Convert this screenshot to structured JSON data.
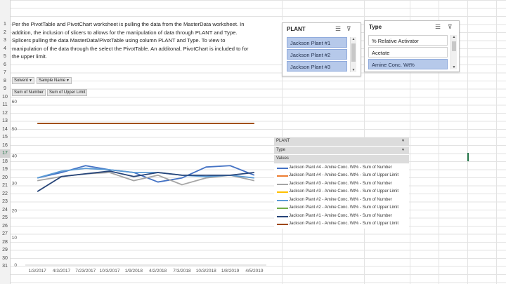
{
  "rows": [
    "1",
    "2",
    "3",
    "4",
    "5",
    "6",
    "7",
    "8",
    "9",
    "10",
    "11",
    "12",
    "13",
    "14",
    "15",
    "16",
    "17",
    "18",
    "19",
    "20",
    "21",
    "22",
    "23",
    "24",
    "25",
    "26",
    "27",
    "28",
    "29",
    "30",
    "31"
  ],
  "active_row": 17,
  "description": {
    "lines": [
      "Per the PivotTable and PivotChart worksheet is pulling the data from the MasterData worksheet. In",
      "addition, the inclusion of slicers to allows for the manipulation of data through PLANT and Type.",
      "Splicers pulling the data MasterData/PivotTable using column PLANT and Type. To view to",
      "manipulation of the data through the select the PivotTable. An additonal, PivotChart is included to for",
      "the upper limit."
    ]
  },
  "pivot_filters": [
    {
      "label": "Solvent",
      "icon": "dropdown-icon"
    },
    {
      "label": "Sample Name",
      "icon": "dropdown-icon"
    }
  ],
  "pivot_values": [
    "Sum of Number",
    "Sum of Upper Limit"
  ],
  "plant_slicer": {
    "title": "PLANT",
    "items": [
      {
        "label": "Jackson Plant #1",
        "selected": true
      },
      {
        "label": "Jackson Plant #2",
        "selected": true
      },
      {
        "label": "Jackson Plant #3",
        "selected": true
      }
    ]
  },
  "type_slicer": {
    "title": "Type",
    "items": [
      {
        "label": "% Relative Activator",
        "selected": false
      },
      {
        "label": "Acetate",
        "selected": false
      },
      {
        "label": "Amine Conc. Wt%",
        "selected": true
      }
    ]
  },
  "legend": {
    "headers": [
      "PLANT",
      "Type",
      "Values"
    ],
    "entries": [
      {
        "label": "Jackson Plant #4 - Amine Conc. Wt% - Sum of Number",
        "color": "#4472c4"
      },
      {
        "label": "Jackson Plant #4 - Amine Conc. Wt% - Sum of Upper Limit",
        "color": "#ed7d31"
      },
      {
        "label": "Jackson Plant #3 - Amine Conc. Wt% - Sum of Number",
        "color": "#a5a5a5"
      },
      {
        "label": "Jackson Plant #3 - Amine Conc. Wt% - Sum of Upper Limit",
        "color": "#ffc000"
      },
      {
        "label": "Jackson Plant #2 - Amine Conc. Wt% - Sum of Number",
        "color": "#5b9bd5"
      },
      {
        "label": "Jackson Plant #2 - Amine Conc. Wt% - Sum of Upper Limit",
        "color": "#70ad47"
      },
      {
        "label": "Jackson Plant #1 - Amine Conc. Wt% - Sum of Number",
        "color": "#264478"
      },
      {
        "label": "Jackson Plant #1 - Amine Conc. Wt% - Sum of Upper Limit",
        "color": "#9e480e"
      }
    ]
  },
  "chart_data": {
    "type": "line",
    "title": "",
    "xlabel": "",
    "ylabel": "",
    "ylim": [
      0,
      60
    ],
    "yticks": [
      0,
      10,
      20,
      30,
      40,
      50,
      60
    ],
    "grid": false,
    "legend_position": "right",
    "categories": [
      "1/3/2017",
      "4/3/2017",
      "7/23/2017",
      "10/3/2017",
      "1/9/2018",
      "4/2/2018",
      "7/3/2018",
      "10/3/2018",
      "1/8/2019",
      "4/5/2019"
    ],
    "series": [
      {
        "name": "Jackson Plant #4 - Amine Conc. Wt% - Sum of Number",
        "color": "#4472c4",
        "values": [
          32,
          34,
          36.5,
          35,
          34,
          30.5,
          32,
          36,
          36.5,
          33
        ]
      },
      {
        "name": "Jackson Plant #3 - Amine Conc. Wt% - Sum of Number",
        "color": "#a5a5a5",
        "values": [
          31,
          32.5,
          33.5,
          34,
          31,
          33,
          29.5,
          32,
          33,
          31
        ]
      },
      {
        "name": "Jackson Plant #2 - Amine Conc. Wt% - Sum of Number",
        "color": "#5b9bd5",
        "values": [
          32,
          34.5,
          35.5,
          35,
          34,
          34,
          33,
          32.5,
          33,
          32
        ]
      },
      {
        "name": "Jackson Plant #1 - Amine Conc. Wt% - Sum of Number",
        "color": "#264478",
        "values": [
          27,
          32.5,
          33.5,
          34.5,
          32.5,
          34,
          33,
          33,
          33,
          34
        ]
      },
      {
        "name": "Jackson Plant #1 - Amine Conc. Wt% - Sum of Upper Limit",
        "color": "#9e480e",
        "values": [
          52,
          52,
          52,
          52,
          52,
          52,
          52,
          52,
          52,
          52
        ]
      }
    ]
  }
}
